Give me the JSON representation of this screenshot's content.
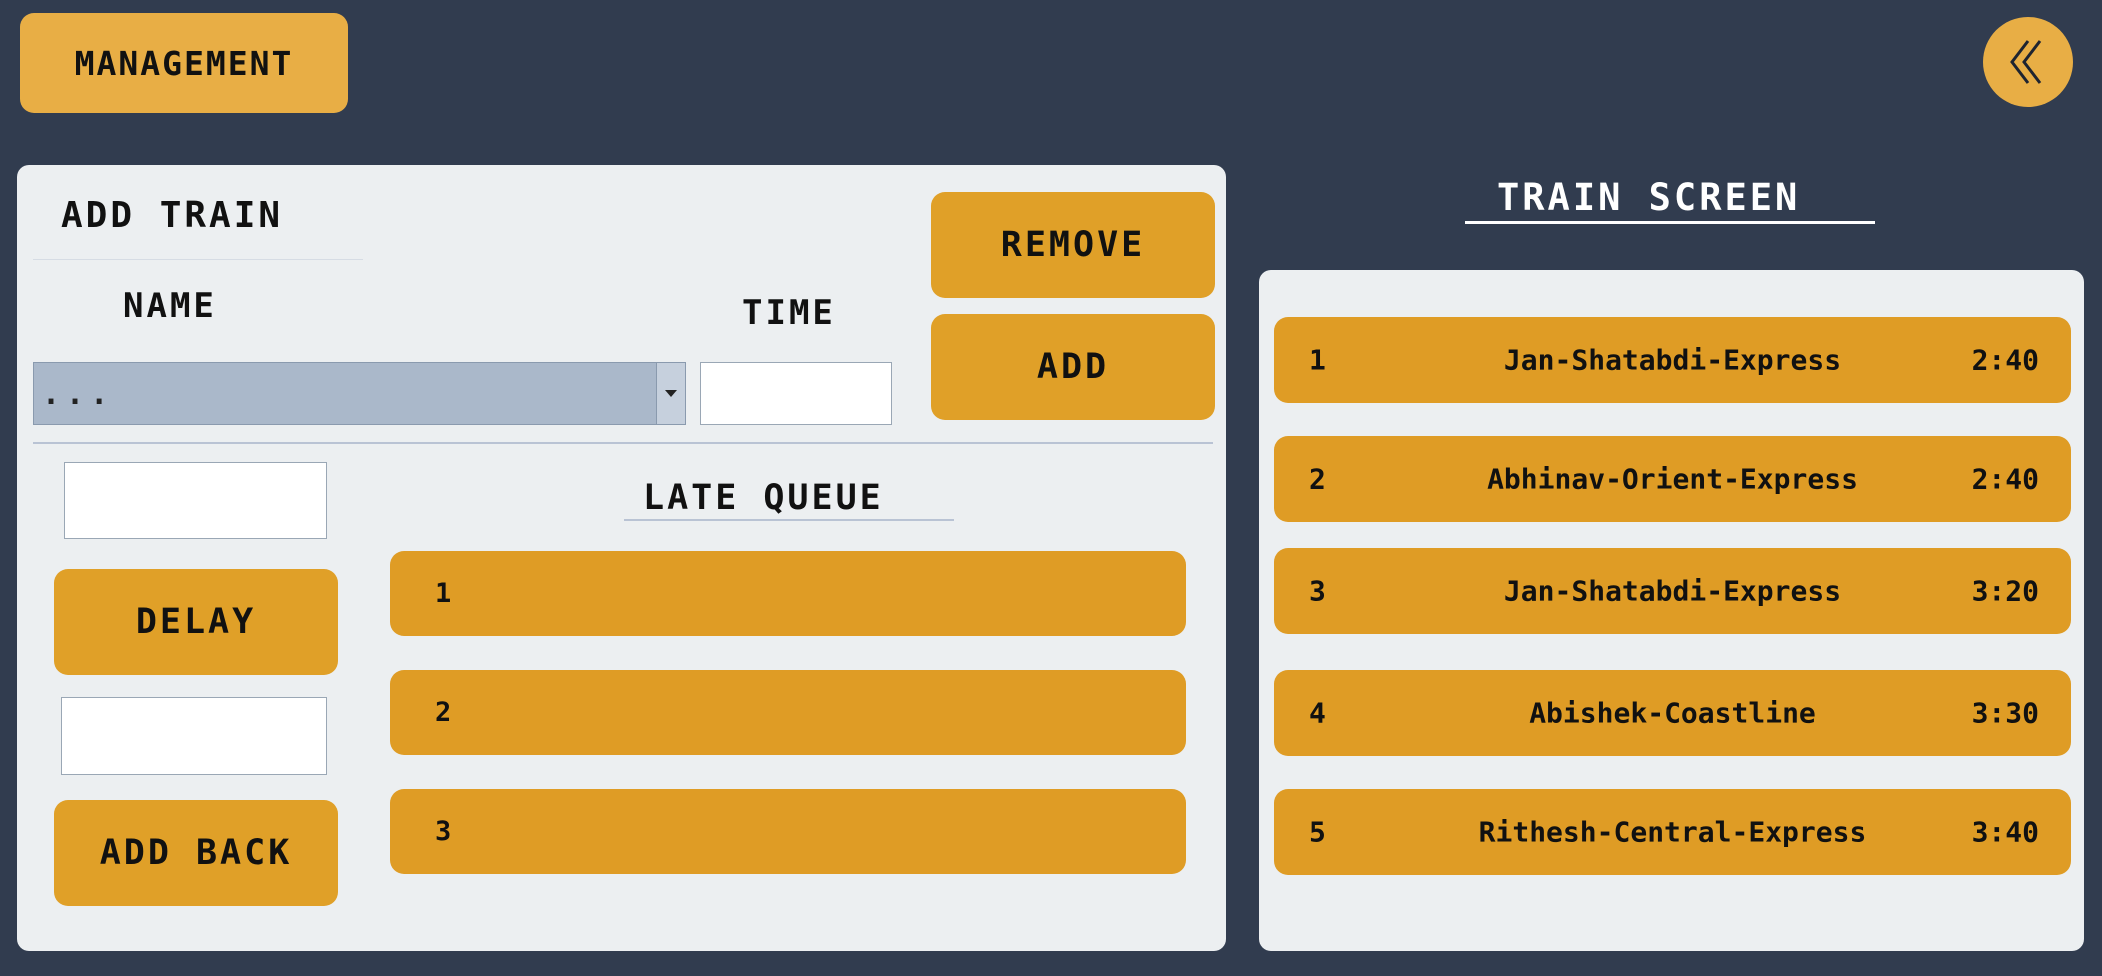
{
  "header": {
    "management_label": "MANAGEMENT",
    "back_icon": "chevron-double-left-icon"
  },
  "add_train": {
    "heading": "ADD TRAIN",
    "name_label": "NAME",
    "time_label": "TIME",
    "name_select_value": "...",
    "time_value": "",
    "remove_label": "REMOVE",
    "add_label": "ADD"
  },
  "delay_section": {
    "delay_input_value": "",
    "delay_label": "DELAY",
    "add_back_input_value": "",
    "add_back_label": "ADD BACK"
  },
  "late_queue": {
    "heading": "LATE QUEUE",
    "rows": [
      {
        "index": "1"
      },
      {
        "index": "2"
      },
      {
        "index": "3"
      }
    ]
  },
  "train_screen": {
    "heading": "TRAIN SCREEN",
    "rows": [
      {
        "index": "1",
        "name": "Jan-Shatabdi-Express",
        "time": "2:40"
      },
      {
        "index": "2",
        "name": "Abhinav-Orient-Express",
        "time": "2:40"
      },
      {
        "index": "3",
        "name": "Jan-Shatabdi-Express",
        "time": "3:20"
      },
      {
        "index": "4",
        "name": "Abishek-Coastline",
        "time": "3:30"
      },
      {
        "index": "5",
        "name": "Rithesh-Central-Express",
        "time": "3:40"
      }
    ]
  },
  "colors": {
    "background": "#313c4f",
    "panel": "#eceff1",
    "accent": "#e0a028",
    "header_button": "#e8ae45"
  }
}
